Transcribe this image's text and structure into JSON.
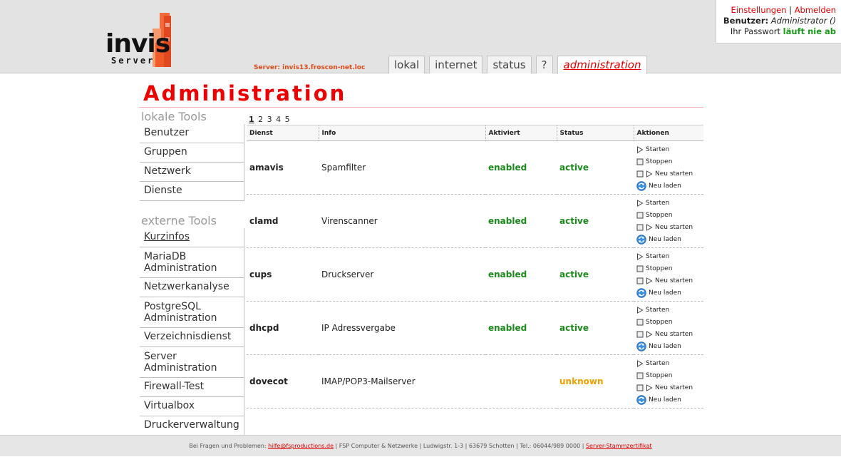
{
  "branding": {
    "logo_text": "invis",
    "logo_subtext": "Server",
    "colors": {
      "accent_red": "#ee0000",
      "ok_green": "#1a8a1a",
      "unknown_orange": "#f0a000"
    }
  },
  "header": {
    "server_label": "Server: invis13.froscon-net.loc",
    "tabs": [
      {
        "label": "lokal",
        "active": false
      },
      {
        "label": "internet",
        "active": false
      },
      {
        "label": "status",
        "active": false
      },
      {
        "label": "?",
        "active": false
      },
      {
        "label": "administration",
        "active": true
      }
    ],
    "user": {
      "settings_label": "Einstellungen",
      "separator": "|",
      "logout_label": "Abmelden",
      "user_prefix": "Benutzer:",
      "user_name": "Administrator ()",
      "password_prefix": "Ihr Passwort",
      "password_status": "läuft nie ab"
    }
  },
  "page": {
    "title": "Administration"
  },
  "sidebar": {
    "local_heading": "lokale Tools",
    "local_items": [
      "Benutzer",
      "Gruppen",
      "Netzwerk",
      "Dienste"
    ],
    "external_heading": "externe Tools",
    "external_items": [
      {
        "line1": "Kurzinfos",
        "line2": ""
      },
      {
        "line1": "MariaDB",
        "line2": "Administration"
      },
      {
        "line1": "Netzwerkanalyse",
        "line2": ""
      },
      {
        "line1": "PostgreSQL",
        "line2": "Administration"
      },
      {
        "line1": "Verzeichnisdienst",
        "line2": ""
      },
      {
        "line1": "Server",
        "line2": "Administration"
      },
      {
        "line1": "Firewall-Test",
        "line2": ""
      },
      {
        "line1": "Virtualbox",
        "line2": ""
      },
      {
        "line1": "Druckerverwaltung",
        "line2": ""
      }
    ]
  },
  "pager": {
    "pages": [
      "1",
      "2",
      "3",
      "4",
      "5"
    ],
    "current": "1"
  },
  "table": {
    "headers": {
      "dienst": "Dienst",
      "info": "Info",
      "aktiviert": "Aktiviert",
      "status": "Status",
      "aktionen": "Aktionen"
    },
    "actions": {
      "start": "Starten",
      "stop": "Stoppen",
      "restart": "Neu starten",
      "reload": "Neu laden"
    },
    "rows": [
      {
        "dienst": "amavis",
        "info": "Spamfilter",
        "aktiviert": "enabled",
        "status": "active"
      },
      {
        "dienst": "clamd",
        "info": "Virenscanner",
        "aktiviert": "enabled",
        "status": "active"
      },
      {
        "dienst": "cups",
        "info": "Druckserver",
        "aktiviert": "enabled",
        "status": "active"
      },
      {
        "dienst": "dhcpd",
        "info": "IP Adressvergabe",
        "aktiviert": "enabled",
        "status": "active"
      },
      {
        "dienst": "dovecot",
        "info": "IMAP/POP3-Mailserver",
        "aktiviert": "",
        "status": "unknown"
      }
    ]
  },
  "footer": {
    "prefix": "Bei Fragen und Problemen:",
    "email": "hilfe@fsproductions.de",
    "company": "| FSP Computer & Netzwerke | Ludwigstr. 1-3 | 63679 Schotten | Tel.: 06044/989 0000 |",
    "cert_link": "Server-Stammzertifikat"
  }
}
